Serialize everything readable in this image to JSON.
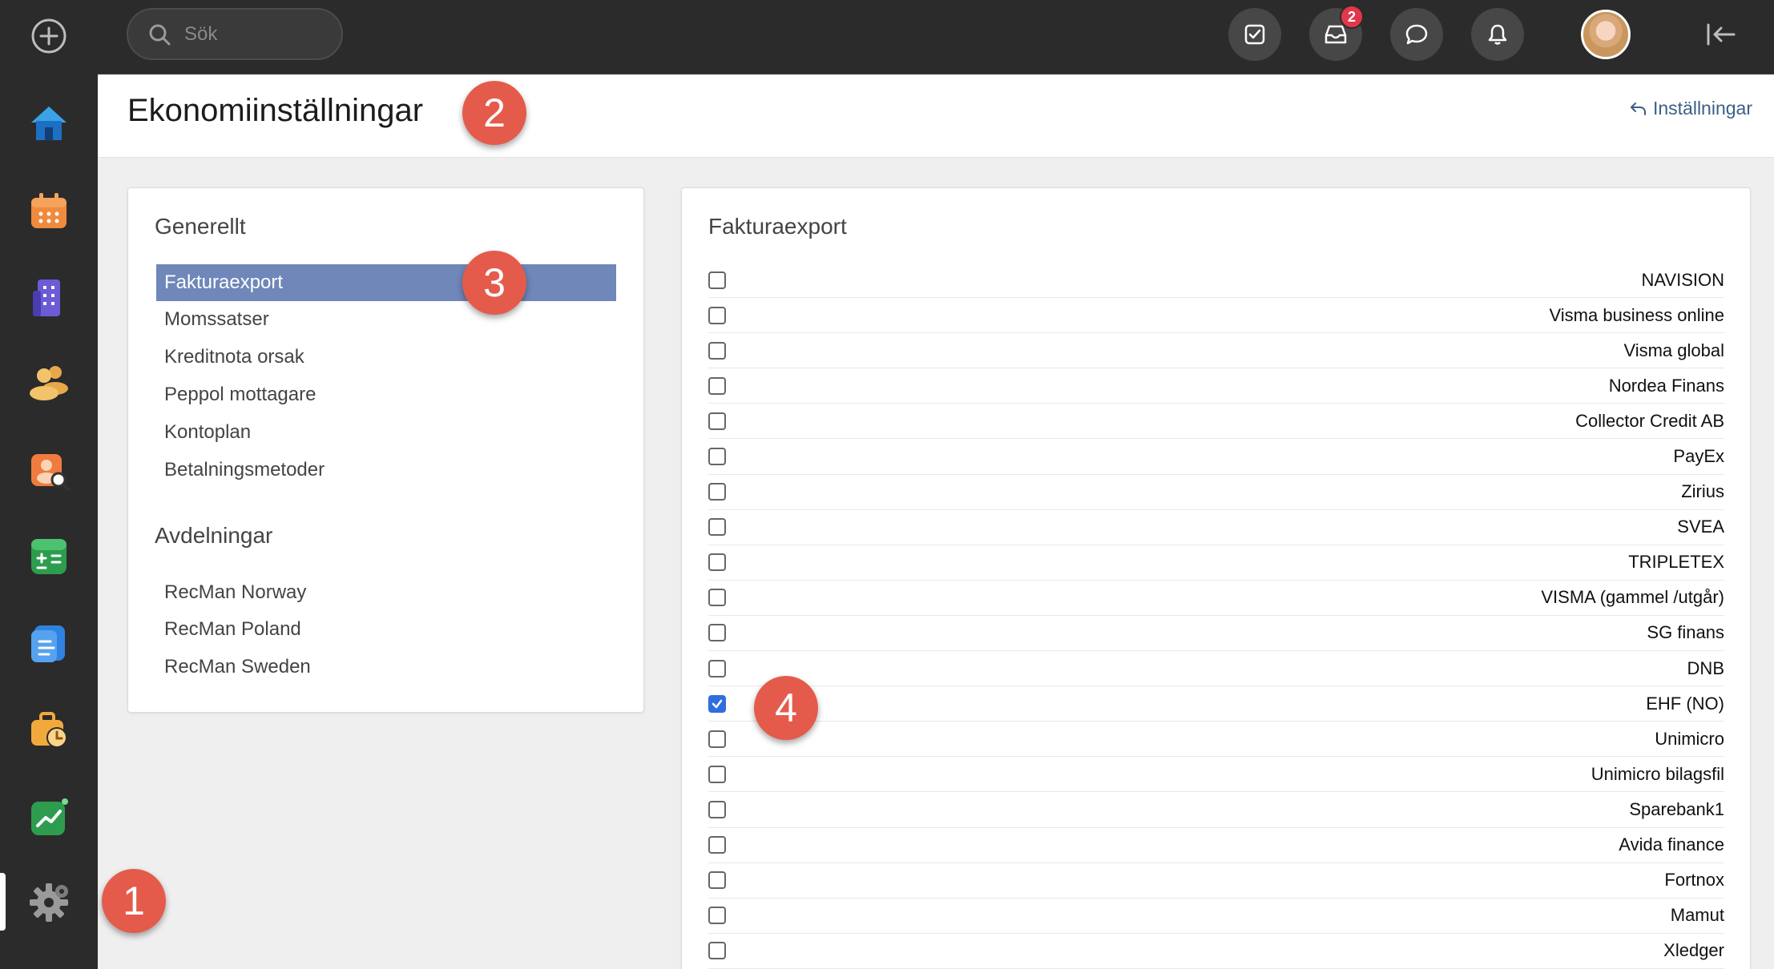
{
  "topbar": {
    "search_placeholder": "Sök",
    "inbox_badge": "2"
  },
  "header": {
    "title": "Ekonomiinställningar",
    "back_link": "Inställningar"
  },
  "callouts": [
    "1",
    "2",
    "3",
    "4"
  ],
  "left_panel": {
    "general_title": "Generellt",
    "general_items": [
      {
        "label": "Fakturaexport",
        "active": true
      },
      {
        "label": "Momssatser",
        "active": false
      },
      {
        "label": "Kreditnota orsak",
        "active": false
      },
      {
        "label": "Peppol mottagare",
        "active": false
      },
      {
        "label": "Kontoplan",
        "active": false
      },
      {
        "label": "Betalningsmetoder",
        "active": false
      }
    ],
    "departments_title": "Avdelningar",
    "department_items": [
      {
        "label": "RecMan Norway"
      },
      {
        "label": "RecMan Poland"
      },
      {
        "label": "RecMan Sweden"
      }
    ]
  },
  "right_panel": {
    "title": "Fakturaexport",
    "exports": [
      {
        "label": "NAVISION",
        "checked": false
      },
      {
        "label": "Visma business online",
        "checked": false
      },
      {
        "label": "Visma global",
        "checked": false
      },
      {
        "label": "Nordea Finans",
        "checked": false
      },
      {
        "label": "Collector Credit AB",
        "checked": false
      },
      {
        "label": "PayEx",
        "checked": false
      },
      {
        "label": "Zirius",
        "checked": false
      },
      {
        "label": "SVEA",
        "checked": false
      },
      {
        "label": "TRIPLETEX",
        "checked": false
      },
      {
        "label": "VISMA (gammel /utgår)",
        "checked": false
      },
      {
        "label": "SG finans",
        "checked": false
      },
      {
        "label": "DNB",
        "checked": false
      },
      {
        "label": "EHF (NO)",
        "checked": true
      },
      {
        "label": "Unimicro",
        "checked": false
      },
      {
        "label": "Unimicro bilagsfil",
        "checked": false
      },
      {
        "label": "Sparebank1",
        "checked": false
      },
      {
        "label": "Avida finance",
        "checked": false
      },
      {
        "label": "Fortnox",
        "checked": false
      },
      {
        "label": "Mamut",
        "checked": false
      },
      {
        "label": "Xledger",
        "checked": false
      }
    ]
  },
  "colors": {
    "sidebar_bg": "#2b2b2b",
    "active_item": "#6f87b9",
    "callout": "#e55b4b",
    "checkbox_checked": "#2f6fde",
    "badge": "#e2374a"
  },
  "icons": {
    "sidebar": [
      "plus-circle-icon",
      "home-icon",
      "calendar-icon",
      "building-icon",
      "people-icon",
      "candidate-search-icon",
      "calculator-icon",
      "document-icon",
      "briefcase-clock-icon",
      "chart-icon",
      "gear-icon"
    ],
    "topbar": [
      "search-icon",
      "checkbox-task-icon",
      "inbox-icon",
      "chat-icon",
      "bell-icon",
      "collapse-icon"
    ]
  }
}
